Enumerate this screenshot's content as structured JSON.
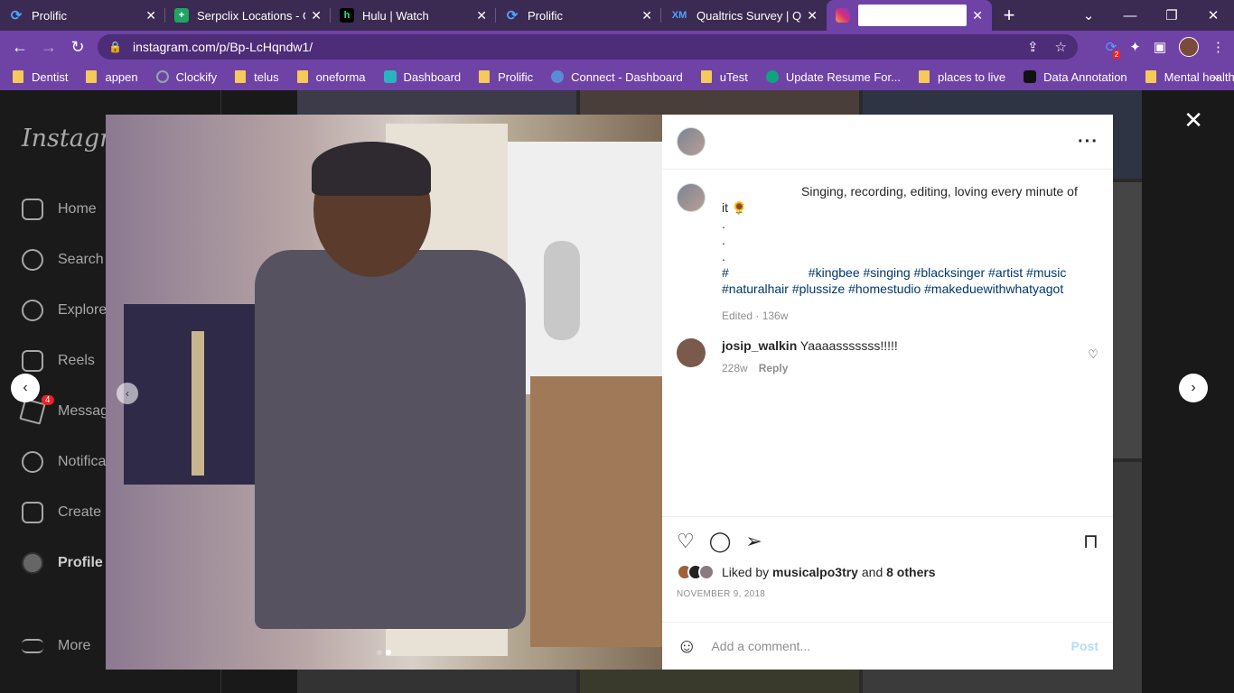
{
  "browser": {
    "tabs": [
      {
        "title": "Prolific",
        "icon": "prolific-icon"
      },
      {
        "title": "Serpclix Locations - Go",
        "icon": "sheets-icon"
      },
      {
        "title": "Hulu | Watch",
        "icon": "hulu-icon"
      },
      {
        "title": "Prolific",
        "icon": "prolific-icon"
      },
      {
        "title": "Qualtrics Survey | Qua",
        "icon": "qualtrics-icon"
      }
    ],
    "url": "instagram.com/p/Bp-LcHqndw1/",
    "bookmarks": [
      "Dentist",
      "appen",
      "Clockify",
      "telus",
      "oneforma",
      "Dashboard",
      "Prolific",
      "Connect - Dashboard",
      "uTest",
      "Update Resume For...",
      "places to live",
      "Data Annotation",
      "Mental health"
    ],
    "ext_badge": "2"
  },
  "sidebar": {
    "logo": "Instagram",
    "items": [
      "Home",
      "Search",
      "Explore",
      "Reels",
      "Messages",
      "Notifications",
      "Create",
      "Profile",
      "More"
    ],
    "messages_badge": "4"
  },
  "post": {
    "caption_line1": "Singing, recording, editing, loving every minute of",
    "caption_line2": "it 🌻",
    "dot": ".",
    "hash_prefix": "#",
    "tags_line1": "#kingbee #singing #blacksinger #artist #music",
    "tags_line2": "#naturalhair #plussize #homestudio #makeduewithwhatyagot",
    "edited": "Edited · 136w",
    "comment_user": "josip_walkin",
    "comment_text": "Yaaaasssssss!!!!!",
    "comment_age": "228w",
    "reply": "Reply",
    "liked_by_prefix": "Liked by",
    "liked_by_user": "musicalpo3try",
    "liked_and": "and",
    "liked_others": "8 others",
    "date": "NOVEMBER 9, 2018",
    "comment_placeholder": "Add a comment...",
    "post_button": "Post"
  }
}
